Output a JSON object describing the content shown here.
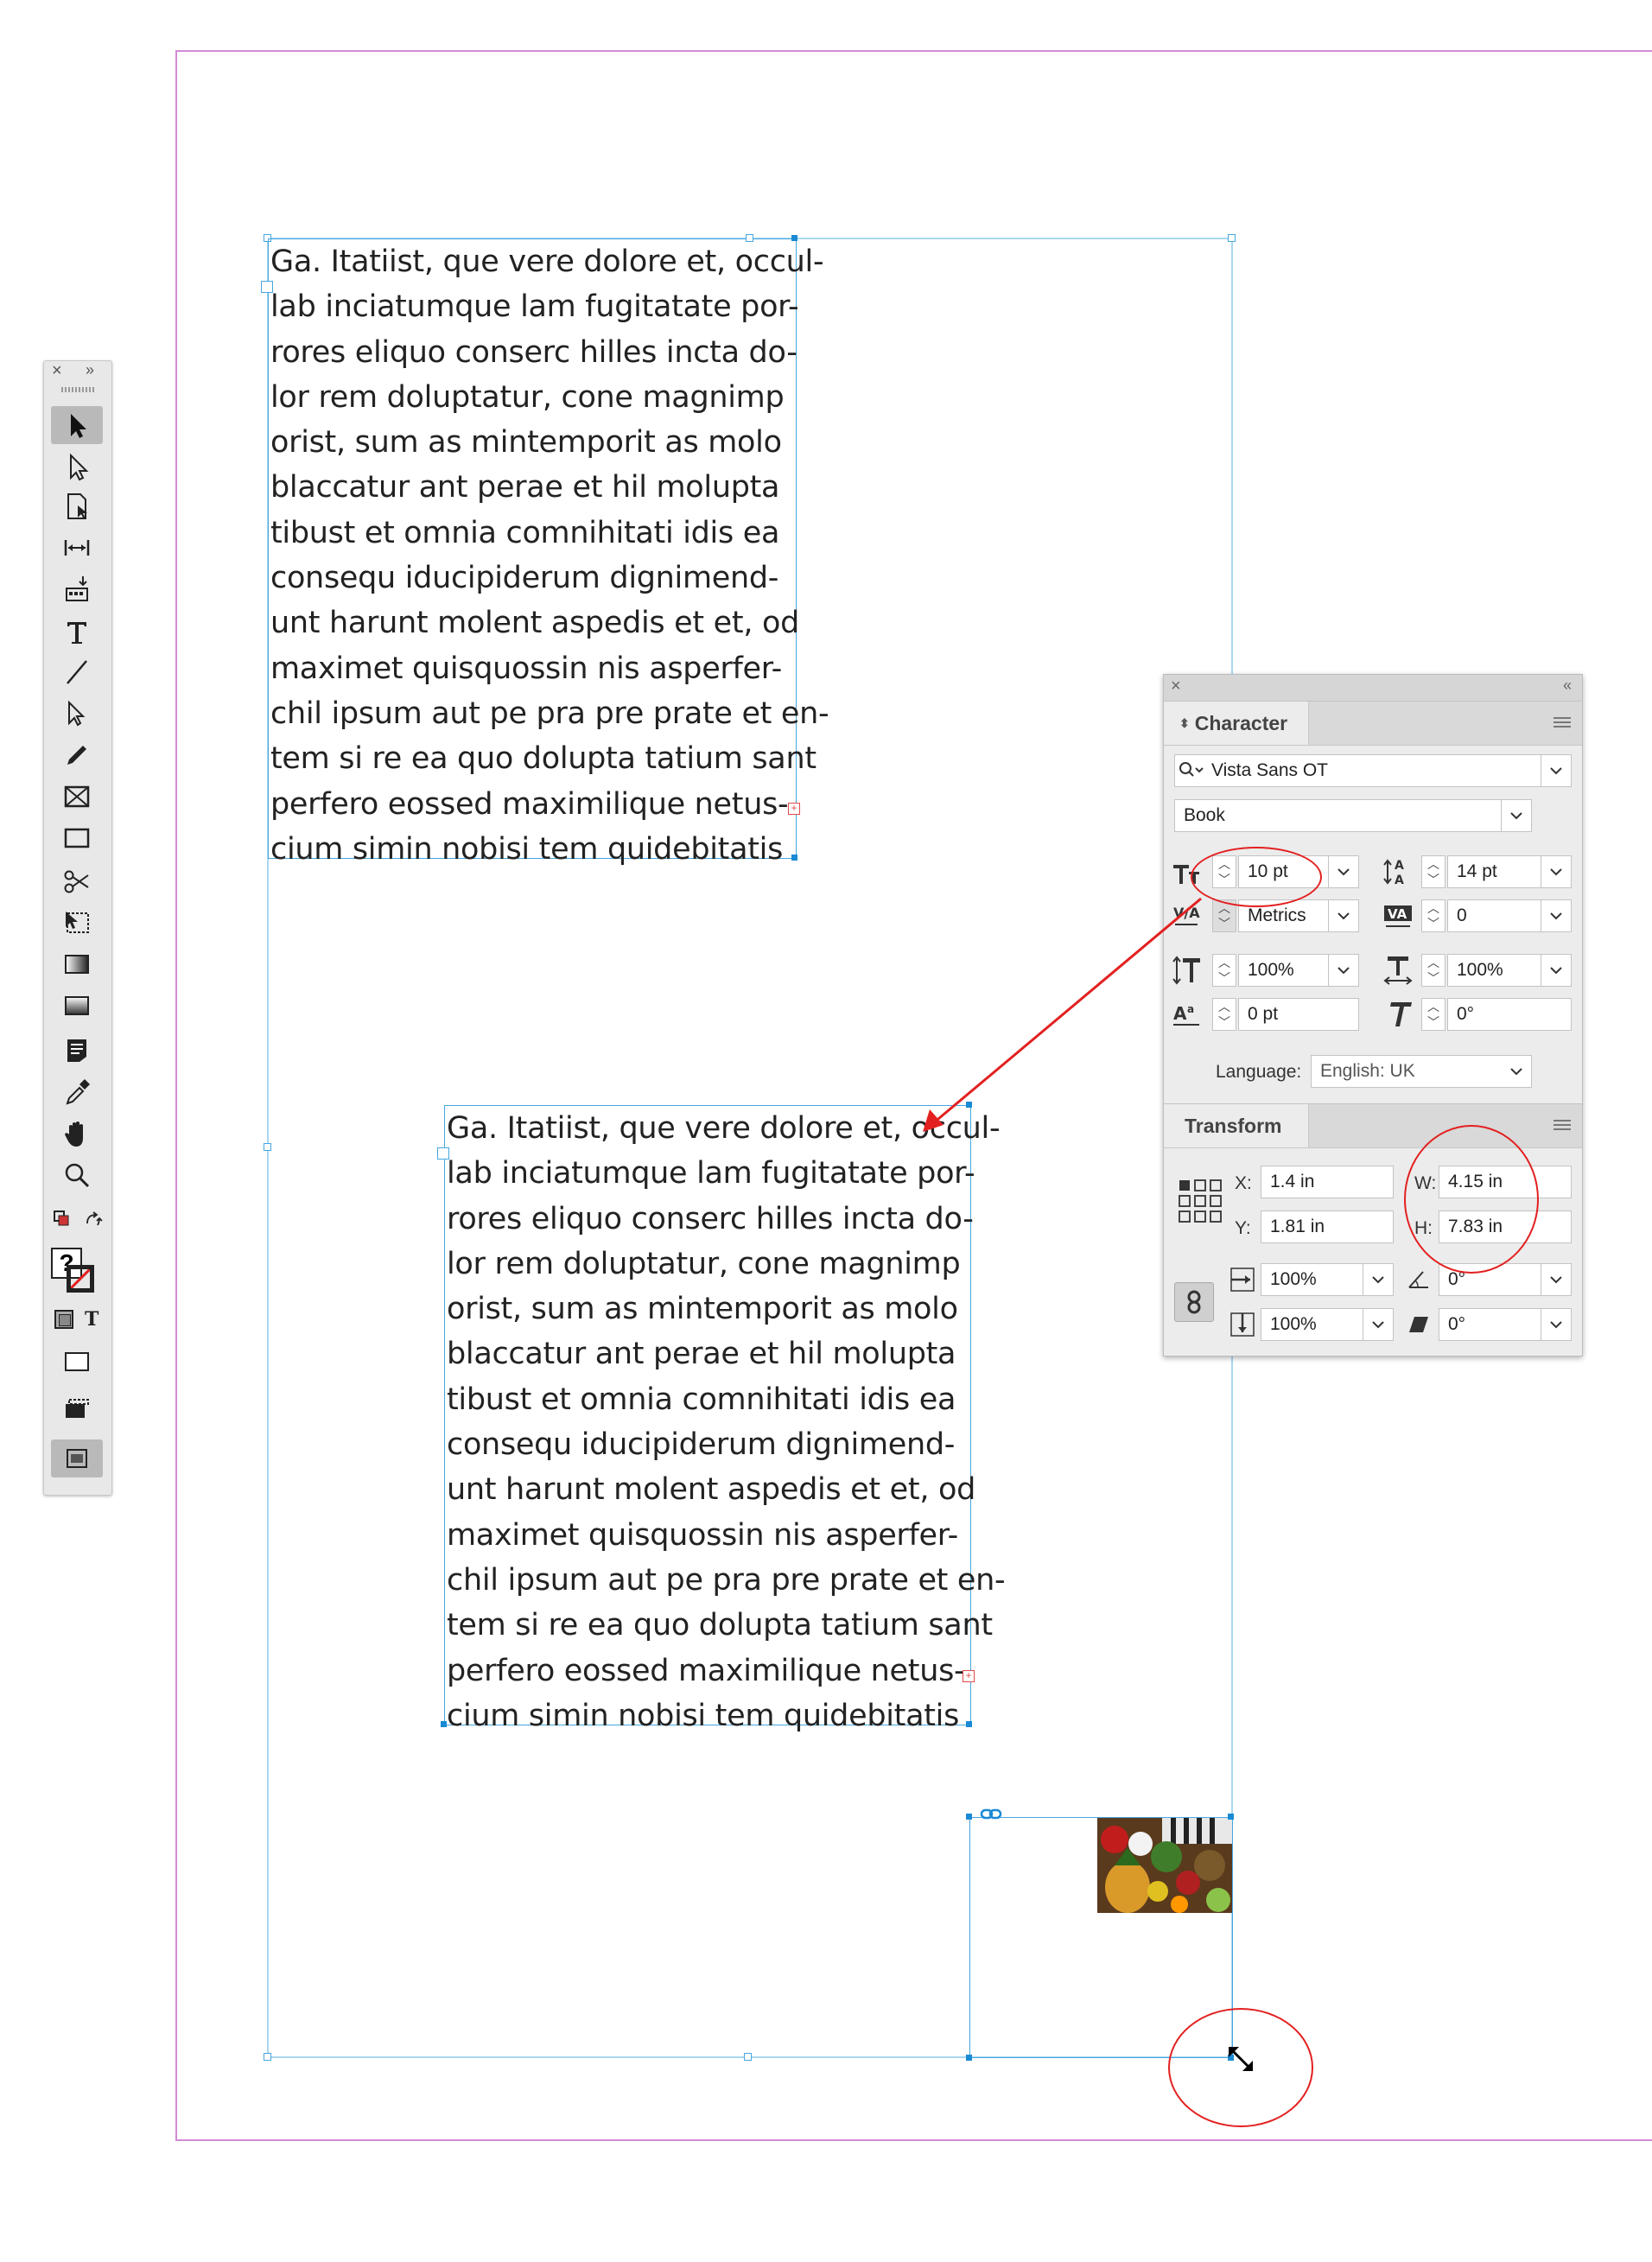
{
  "story_text": {
    "lines": [
      "Ga. Itatiist, que vere dolore et, occul-",
      "lab inciatumque lam fugitatate por-",
      "rores eliquo conserc hilles incta do-",
      "lor rem doluptatur, cone magnimp",
      "orist, sum as mintemporit as molo",
      "blaccatur ant perae et hil molupta",
      "tibust et omnia comnihitati idis ea",
      "consequ iducipiderum dignimend-",
      "unt harunt molent aspedis et et, od",
      "maximet quisquossin nis asperfer-",
      "chil ipsum aut pe pra pre prate et en-",
      "tem si re ea quo dolupta tatium sant",
      "perfero eossed maximilique netus-",
      "cium simin nobisi tem quidebitatis"
    ]
  },
  "tools_panel": {
    "close_glyph": "×",
    "collapse_glyph": "»",
    "fill_stroke_question": "?",
    "text_mode_label": "T"
  },
  "character_panel": {
    "title": "Character",
    "font_family": "Vista Sans OT",
    "font_style": "Book",
    "font_size": "10 pt",
    "leading": "14 pt",
    "kerning": "Metrics",
    "tracking": "0",
    "vertical_scale": "100%",
    "horizontal_scale": "100%",
    "baseline_shift": "0 pt",
    "skew": "0°",
    "language_label": "Language:",
    "language_value": "English: UK"
  },
  "transform_panel": {
    "title": "Transform",
    "x_label": "X:",
    "x_value": "1.4 in",
    "y_label": "Y:",
    "y_value": "1.81 in",
    "w_label": "W:",
    "w_value": "4.15 in",
    "h_label": "H:",
    "h_value": "7.83 in",
    "scale_x": "100%",
    "scale_y": "100%",
    "rotation": "0°",
    "shear": "0°"
  },
  "annotation_color": "#e32020",
  "frame_color": "#45a6e0",
  "margin_color": "#d38bd6"
}
